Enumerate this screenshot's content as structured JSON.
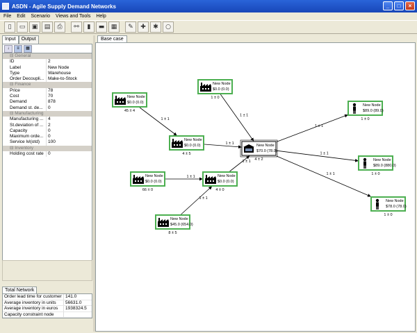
{
  "window": {
    "title": "ASDN - Agile Supply Demand Networks"
  },
  "menu": [
    "File",
    "Edit",
    "Scenario",
    "Views and Tools",
    "Help"
  ],
  "toolbar_icons": [
    "new-icon",
    "open-icon",
    "save-icon",
    "save-as-icon",
    "print-icon",
    "network-icon",
    "chart-icon",
    "camera-icon",
    "report-icon",
    "wrench-icon",
    "wrench-plus-icon",
    "wrench-settings-icon",
    "comment-icon"
  ],
  "left_tabs": [
    "Input",
    "Output"
  ],
  "properties": [
    {
      "cat": true,
      "k": "General"
    },
    {
      "k": "ID",
      "v": "2"
    },
    {
      "k": "Label",
      "v": "New Node"
    },
    {
      "k": "Type",
      "v": "Warehouse"
    },
    {
      "k": "Order Decoupli...",
      "v": "Make-to-Stock"
    },
    {
      "cat": true,
      "k": "Finance"
    },
    {
      "k": "Price",
      "v": "78"
    },
    {
      "k": "Cost",
      "v": "70"
    },
    {
      "k": "Demand",
      "v": "878"
    },
    {
      "k": "Demand st. de...",
      "v": "0"
    },
    {
      "cat": true,
      "k": "Manufacturing"
    },
    {
      "k": "Manufacturing ...",
      "v": "4"
    },
    {
      "k": "St.deviation of ...",
      "v": "2"
    },
    {
      "k": "Capacity",
      "v": "0"
    },
    {
      "k": "Maximum orde...",
      "v": "0"
    },
    {
      "k": "Service lvl(otd)",
      "v": "100"
    },
    {
      "cat": true,
      "k": "Inventory"
    },
    {
      "k": "Holding cost rate",
      "v": "0"
    }
  ],
  "totals": {
    "tab": "Total Network",
    "rows": [
      {
        "k": "Order lead time for customer",
        "v": "141.0"
      },
      {
        "k": "Average inventory in units",
        "v": "56631.0"
      },
      {
        "k": "Average inventory in euros",
        "v": "1938324.5"
      },
      {
        "k": "Capacity constraint node",
        "v": ""
      }
    ]
  },
  "canvas": {
    "tab": "Base case",
    "nodes": [
      {
        "id": "A",
        "icon": "factory",
        "label": "New Node",
        "value": "$0.0 (0.0)",
        "stat": "45 ± 4",
        "selected": false
      },
      {
        "id": "B",
        "icon": "factory",
        "label": "New Node",
        "value": "$0.0 (0.0)",
        "stat": "1 ± 0",
        "selected": false
      },
      {
        "id": "C",
        "icon": "factory",
        "label": "New Node",
        "value": "$0.0 (0.0)",
        "stat": "4 ± 5",
        "selected": false
      },
      {
        "id": "D",
        "icon": "warehouse",
        "label": "New Node",
        "value": "$70.0 (78.0)",
        "stat": "4 ± 2",
        "selected": true
      },
      {
        "id": "E",
        "icon": "factory",
        "label": "New Node",
        "value": "$0.0 (0.0)",
        "stat": "66 ± 0",
        "selected": false
      },
      {
        "id": "F",
        "icon": "factory",
        "label": "New Node",
        "value": "$0.0 (0.0)",
        "stat": "4 ± 0",
        "selected": false
      },
      {
        "id": "G",
        "icon": "factory",
        "label": "New Node",
        "value": "$45.0 (654.0)",
        "stat": "8 ± 5",
        "selected": false
      },
      {
        "id": "H",
        "icon": "customer",
        "label": "New Node",
        "value": "$89.0 (89.0)",
        "stat": "1 ± 0",
        "selected": false
      },
      {
        "id": "I",
        "icon": "customer",
        "label": "New Node",
        "value": "$89.0 (880.0)",
        "stat": "1 ± 0",
        "selected": false
      },
      {
        "id": "J",
        "icon": "customer",
        "label": "New Node",
        "value": "$78.0 (78.0)",
        "stat": "1 ± 0",
        "selected": false
      }
    ],
    "edges": [
      {
        "from": "A",
        "to": "C",
        "label": "1 ± 1"
      },
      {
        "from": "B",
        "to": "D",
        "label": "1 ± 1"
      },
      {
        "from": "C",
        "to": "D",
        "label": "1 ± 1"
      },
      {
        "from": "E",
        "to": "F",
        "label": "1 ± 1"
      },
      {
        "from": "F",
        "to": "D",
        "label": "1 ± 1"
      },
      {
        "from": "G",
        "to": "F",
        "label": "1 ± 1"
      },
      {
        "from": "D",
        "to": "H",
        "label": "1 ± 1"
      },
      {
        "from": "D",
        "to": "I",
        "label": "1 ± 1"
      },
      {
        "from": "D",
        "to": "J",
        "label": "1 ± 1"
      }
    ]
  }
}
